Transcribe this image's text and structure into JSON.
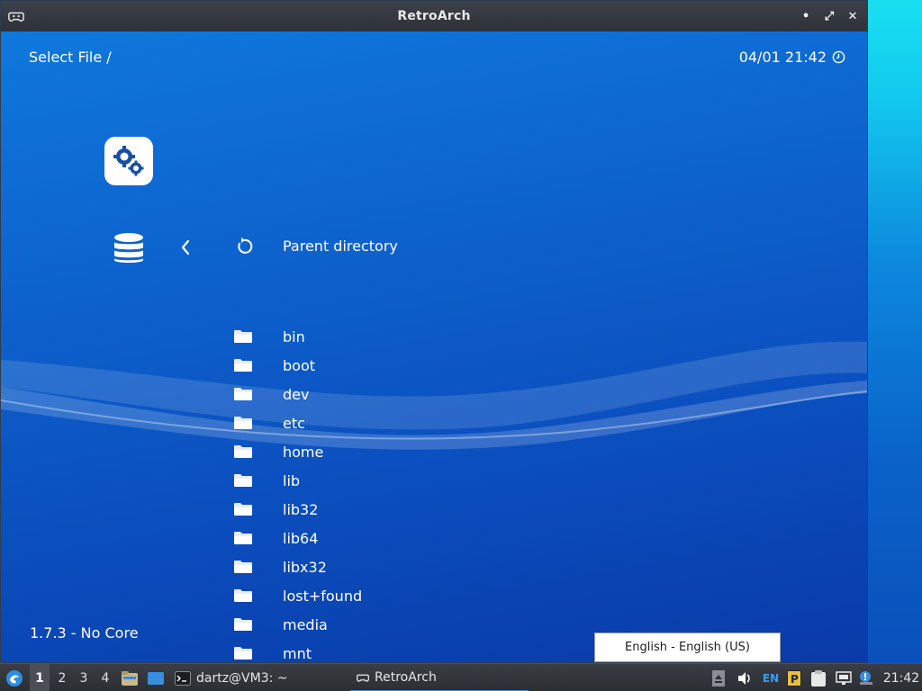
{
  "window": {
    "title": "RetroArch",
    "controls": {
      "minimize": "•",
      "maximize": "⤢",
      "close": "✕"
    }
  },
  "header": {
    "breadcrumb": "Select File /",
    "datetime": "04/01 21:42"
  },
  "nav": {
    "parent_label": "Parent directory"
  },
  "files": [
    {
      "label": "bin"
    },
    {
      "label": "boot"
    },
    {
      "label": "dev"
    },
    {
      "label": "etc"
    },
    {
      "label": "home"
    },
    {
      "label": "lib"
    },
    {
      "label": "lib32"
    },
    {
      "label": "lib64"
    },
    {
      "label": "libx32"
    },
    {
      "label": "lost+found"
    },
    {
      "label": "media"
    },
    {
      "label": "mnt"
    }
  ],
  "footer": {
    "version": "1.7.3 - No Core"
  },
  "tooltip": {
    "text": "English - English (US)"
  },
  "taskbar": {
    "workspaces": [
      "1",
      "2",
      "3",
      "4"
    ],
    "terminal_task": "dartz@VM3: ~",
    "retroarch_task": "RetroArch",
    "lang": "EN",
    "clock": "21:42"
  },
  "colors": {
    "background_top": "#0f78dc",
    "background_bottom": "#0a3aa8",
    "titlebar": "#35383e",
    "taskbar": "#2f3238",
    "accent": "#2e8ee0"
  },
  "icons": {
    "app": "gamepad-icon",
    "settings": "gears-icon",
    "database": "database-icon",
    "back": "chevron-left-icon",
    "refresh": "refresh-icon",
    "folder": "folder-icon",
    "clock": "clock-icon"
  }
}
